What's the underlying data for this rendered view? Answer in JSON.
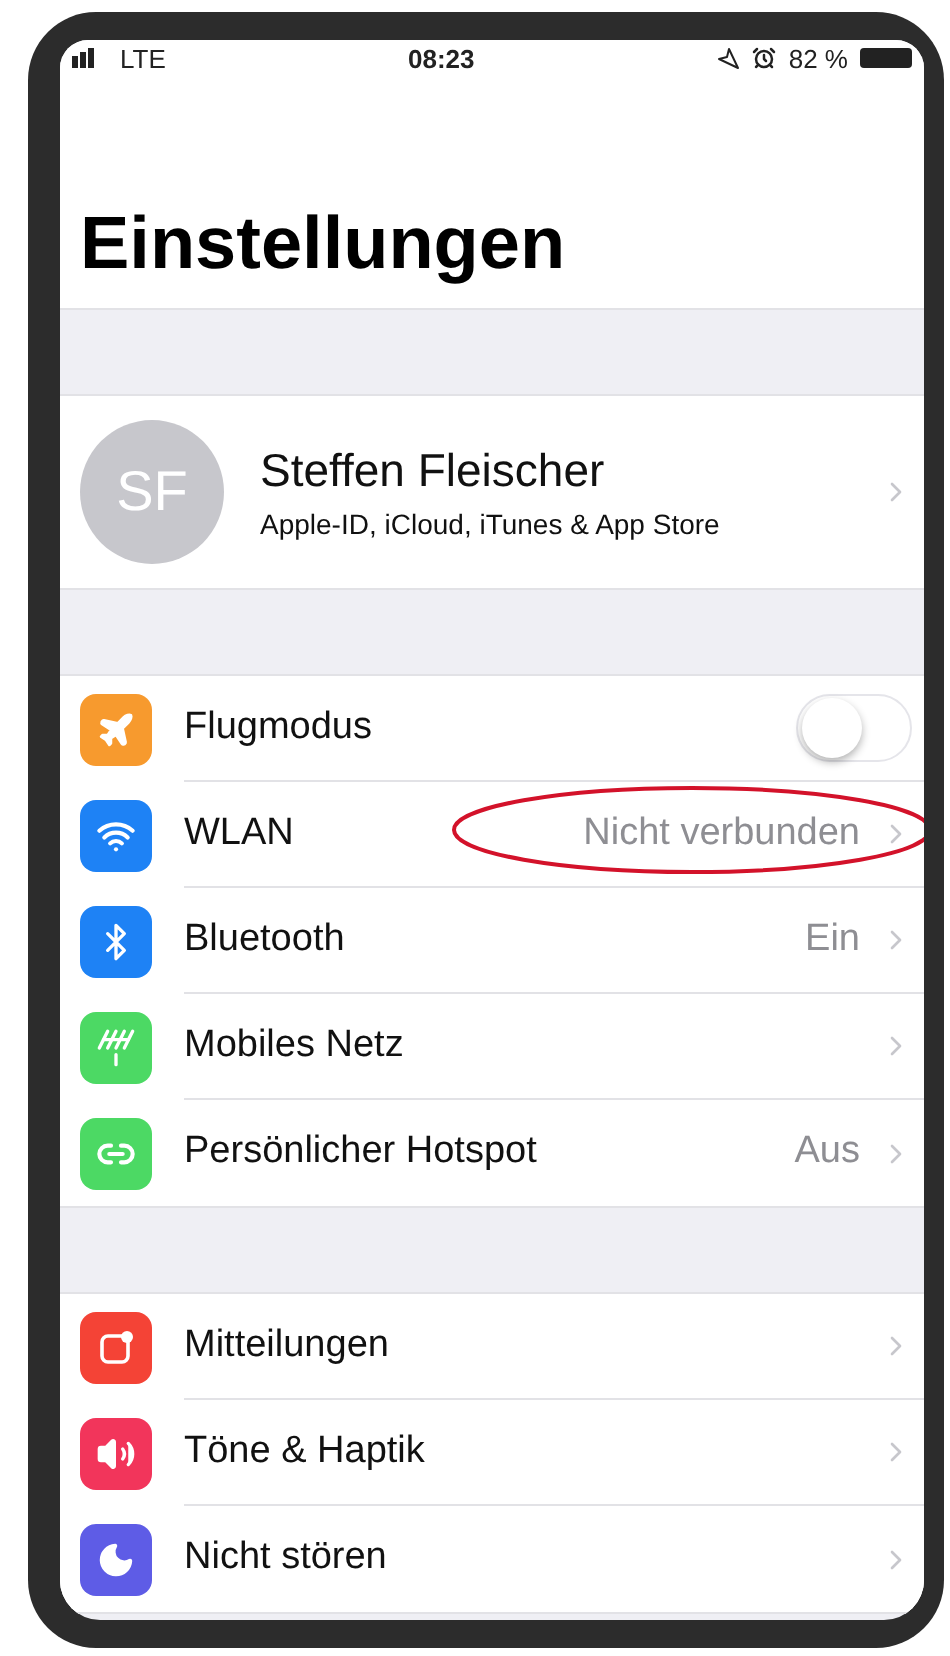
{
  "status_bar": {
    "carrier": "LTE",
    "time": "08:23",
    "battery": "82 %"
  },
  "title": "Einstellungen",
  "profile": {
    "initials": "SF",
    "name": "Steffen Fleischer",
    "subtitle": "Apple-ID, iCloud, iTunes & App Store"
  },
  "groups": [
    {
      "rows": [
        {
          "kind": "toggle",
          "color": "#f79a2e",
          "label": "Flugmodus",
          "on": false,
          "highlighted": false
        },
        {
          "kind": "link",
          "color": "#1e82f5",
          "label": "WLAN",
          "value": "Nicht verbunden",
          "highlighted": true
        },
        {
          "kind": "link",
          "color": "#1e82f5",
          "label": "Bluetooth",
          "value": "Ein",
          "highlighted": false
        },
        {
          "kind": "link",
          "color": "#4cd964",
          "label": "Mobiles Netz",
          "highlighted": false
        },
        {
          "kind": "link",
          "color": "#4cd964",
          "label": "Persönlicher Hotspot",
          "value": "Aus",
          "highlighted": false
        }
      ]
    },
    {
      "rows": [
        {
          "kind": "link",
          "color": "#f44336",
          "label": "Mitteilungen",
          "highlighted": false
        },
        {
          "kind": "link",
          "color": "#f2355b",
          "label": "Töne & Haptik",
          "highlighted": false
        },
        {
          "kind": "link",
          "color": "#5e5ce6",
          "label": "Nicht stören",
          "highlighted": false
        }
      ]
    }
  ]
}
